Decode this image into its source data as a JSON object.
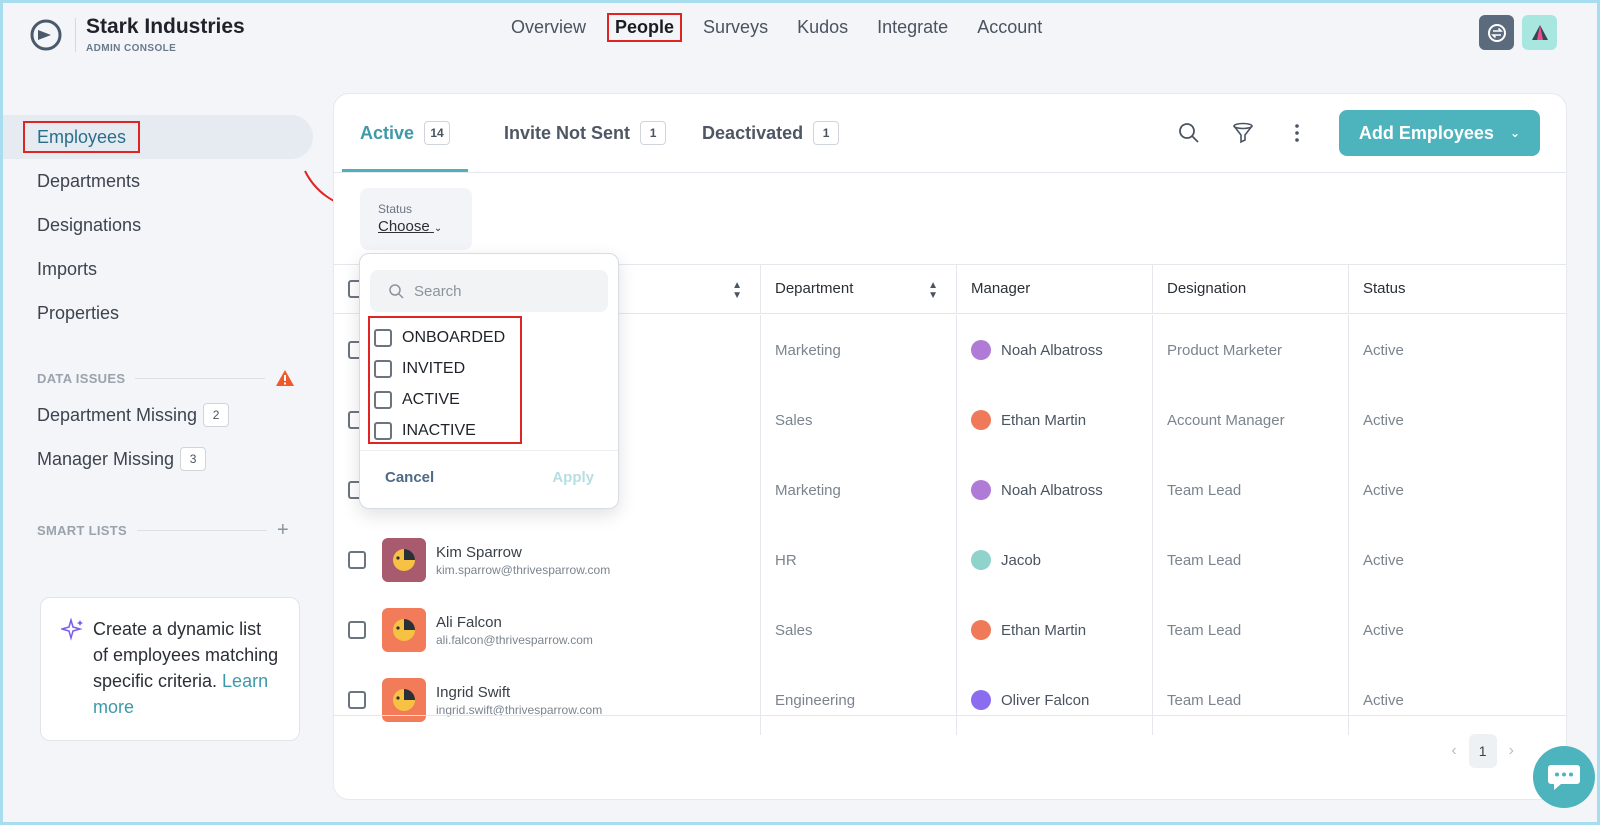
{
  "brand": {
    "name": "Stark Industries",
    "subtitle": "ADMIN CONSOLE"
  },
  "nav": [
    {
      "label": "Overview"
    },
    {
      "label": "People",
      "active": true
    },
    {
      "label": "Surveys"
    },
    {
      "label": "Kudos"
    },
    {
      "label": "Integrate"
    },
    {
      "label": "Account"
    }
  ],
  "sidebar": {
    "items": [
      {
        "label": "Employees"
      },
      {
        "label": "Departments"
      },
      {
        "label": "Designations"
      },
      {
        "label": "Imports"
      },
      {
        "label": "Properties"
      }
    ],
    "data_issues": {
      "title": "DATA ISSUES",
      "items": [
        {
          "label": "Department Missing",
          "count": "2"
        },
        {
          "label": "Manager Missing",
          "count": "3"
        }
      ]
    },
    "smart_lists": {
      "title": "SMART LISTS",
      "card_text": "Create a dynamic list of employees matching specific criteria.",
      "link": "Learn more"
    }
  },
  "tabs": [
    {
      "label": "Active",
      "count": "14"
    },
    {
      "label": "Invite Not Sent",
      "count": "1"
    },
    {
      "label": "Deactivated",
      "count": "1"
    }
  ],
  "add_button": "Add Employees",
  "filter": {
    "label": "Status",
    "value": "Choose"
  },
  "dropdown": {
    "search_placeholder": "Search",
    "options": [
      "ONBOARDED",
      "INVITED",
      "ACTIVE",
      "INACTIVE"
    ],
    "cancel": "Cancel",
    "apply": "Apply"
  },
  "table": {
    "headers": {
      "department": "Department",
      "manager": "Manager",
      "designation": "Designation",
      "status": "Status"
    },
    "rows": [
      {
        "name": "",
        "email": "",
        "department": "Marketing",
        "manager": "Noah Albatross",
        "designation": "Product Marketer",
        "status": "Active"
      },
      {
        "name": "",
        "email": "",
        "department": "Sales",
        "manager": "Ethan Martin",
        "designation": "Account Manager",
        "status": "Active"
      },
      {
        "name": "",
        "email": "",
        "department": "Marketing",
        "manager": "Noah Albatross",
        "designation": "Team Lead",
        "status": "Active"
      },
      {
        "name": "Kim Sparrow",
        "email": "kim.sparrow@thrivesparrow.com",
        "department": "HR",
        "manager": "Jacob",
        "designation": "Team Lead",
        "status": "Active"
      },
      {
        "name": "Ali Falcon",
        "email": "ali.falcon@thrivesparrow.com",
        "department": "Sales",
        "manager": "Ethan Martin",
        "designation": "Team Lead",
        "status": "Active"
      },
      {
        "name": "Ingrid Swift",
        "email": "ingrid.swift@thrivesparrow.com",
        "department": "Engineering",
        "manager": "Oliver Falcon",
        "designation": "Team Lead",
        "status": "Active"
      }
    ]
  },
  "pagination": {
    "page": "1"
  },
  "colors": {
    "accent": "#4db3bd",
    "highlight": "#e02424",
    "warning": "#f05a28"
  }
}
